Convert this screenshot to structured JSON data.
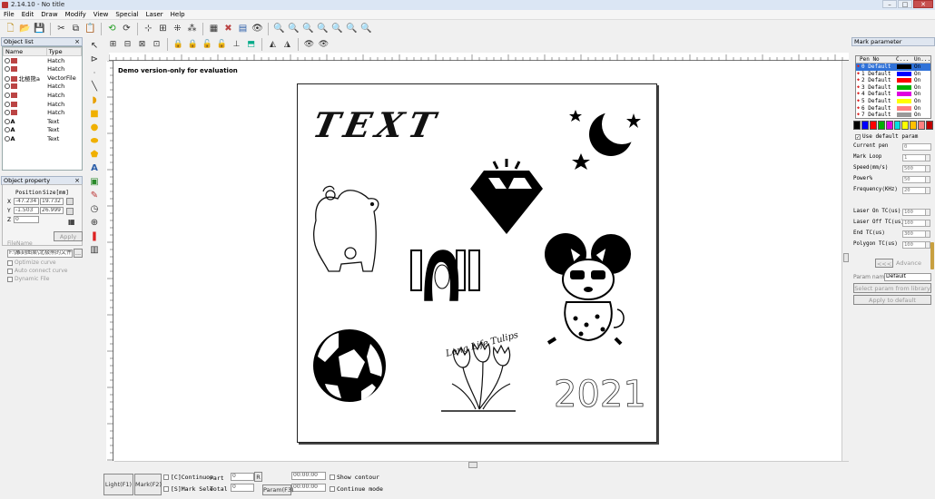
{
  "app": {
    "title": "2.14.10 - No title"
  },
  "window_buttons": {
    "minimize": "–",
    "maximize": "□",
    "close": "✕"
  },
  "menu": [
    "File",
    "Edit",
    "Draw",
    "Modify",
    "View",
    "Special",
    "Laser",
    "Help"
  ],
  "object_list": {
    "title": "Object list",
    "columns": [
      "Name",
      "Type"
    ],
    "rows": [
      {
        "name": "",
        "type": "Hatch",
        "kind": "hatch"
      },
      {
        "name": "",
        "type": "Hatch",
        "kind": "hatch"
      },
      {
        "name": "北極熊a",
        "type": "VectorFile",
        "kind": "vector"
      },
      {
        "name": "",
        "type": "Hatch",
        "kind": "hatch"
      },
      {
        "name": "",
        "type": "Hatch",
        "kind": "hatch"
      },
      {
        "name": "",
        "type": "Hatch",
        "kind": "hatch"
      },
      {
        "name": "",
        "type": "Hatch",
        "kind": "hatch"
      },
      {
        "name": "A",
        "type": "Text",
        "kind": "text"
      },
      {
        "name": "A",
        "type": "Text",
        "kind": "text"
      },
      {
        "name": "A",
        "type": "Text",
        "kind": "text"
      }
    ]
  },
  "object_property": {
    "title": "Object property",
    "position_label": "Position",
    "size_label": "Size[mm]",
    "x_label": "X",
    "y_label": "Y",
    "z_label": "Z",
    "x_value": "-47.234",
    "y_value": "-1.503",
    "z_value": "0",
    "w_value": "19.732",
    "h_value": "26.999",
    "apply": "Apply",
    "filename_label": "FileName",
    "filename_value": "F:\\雕刻图案\\北极熊的文件\\C",
    "dots": "...",
    "optimize": "Optimize curve",
    "auto_connect": "Auto connect curve",
    "dynamic_file": "Dynamic File"
  },
  "canvas": {
    "demo_text": "Demo version-only for evaluation",
    "artwork_text": "TEXT",
    "tulips_caption": "Long Life Tulips",
    "year": "2021"
  },
  "bottom": {
    "light": "Light(F1)",
    "mark": "Mark(F2)",
    "continuous": "[C]Continuou",
    "select_mark": "[S]Mark Sele",
    "part_label": "Part",
    "part_value": "0",
    "total_label": "Total",
    "total_value": "0",
    "r_button": "R",
    "time1": "00:00:00",
    "time2": "00:00:00",
    "param": "Param(F3)",
    "show_contour": "Show contour",
    "continue_mode": "Continue mode"
  },
  "mark_parameter": {
    "title": "Mark parameter",
    "columns": [
      "Pen No",
      "C...",
      "Un..."
    ],
    "pens": [
      {
        "label": "0 Default",
        "color": "#000000",
        "state": "On"
      },
      {
        "label": "1 Default",
        "color": "#0000ff",
        "state": "On"
      },
      {
        "label": "2 Default",
        "color": "#ff0000",
        "state": "On"
      },
      {
        "label": "3 Default",
        "color": "#00b000",
        "state": "On"
      },
      {
        "label": "4 Default",
        "color": "#e000e0",
        "state": "On"
      },
      {
        "label": "5 Default",
        "color": "#ffff00",
        "state": "On"
      },
      {
        "label": "6 Default",
        "color": "#ff8080",
        "state": "On"
      },
      {
        "label": "7 Default",
        "color": "#999999",
        "state": "On"
      }
    ],
    "palette": [
      "#000000",
      "#0000ff",
      "#ff0000",
      "#00b000",
      "#e000e0",
      "#00e0e0",
      "#ffff00",
      "#ffc000",
      "#ff8080",
      "#c00000"
    ],
    "use_default": "Use default param",
    "current_pen_label": "Current pen",
    "current_pen": "0",
    "params": [
      {
        "label": "Mark Loop",
        "value": "1"
      },
      {
        "label": "Speed(mm/s)",
        "value": "500"
      },
      {
        "label": "Power%",
        "value": "50"
      },
      {
        "label": "Frequency(KHz)",
        "value": "20"
      },
      {
        "label": "",
        "value": ""
      },
      {
        "label": "Laser On TC(us)",
        "value": "100"
      },
      {
        "label": "Laser Off TC(us)",
        "value": "100"
      },
      {
        "label": "End TC(us)",
        "value": "300"
      },
      {
        "label": "Polygon TC(us)",
        "value": "100"
      }
    ],
    "more": "<<<",
    "advance": "Advance",
    "param_name_label": "Param name",
    "param_name": "Default",
    "select_library": "Select param from library",
    "apply_default": "Apply to default"
  }
}
